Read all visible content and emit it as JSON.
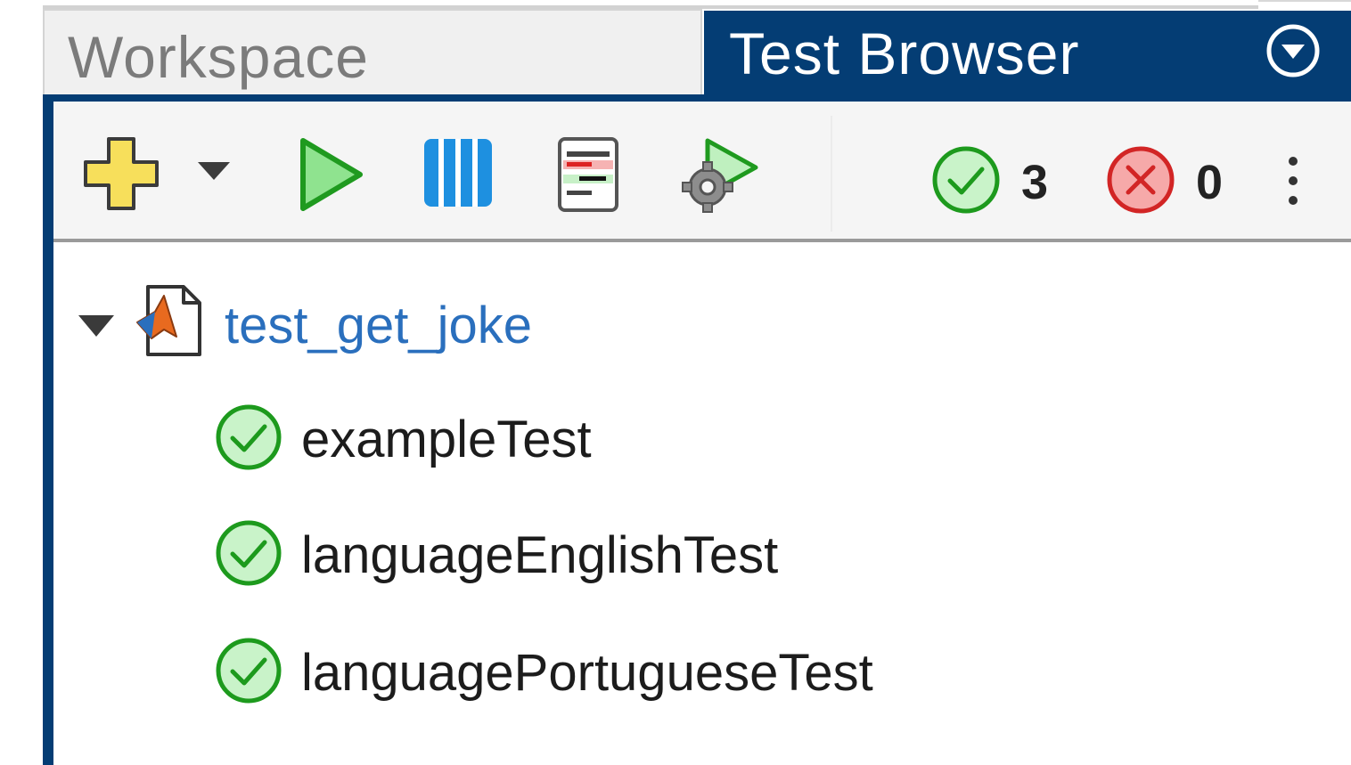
{
  "tabs": [
    {
      "label": "Workspace",
      "active": false
    },
    {
      "label": "Test Browser",
      "active": true
    }
  ],
  "colors": {
    "active_tab": "#043d74",
    "pass": "#2aa52a",
    "fail": "#d62c2c",
    "link": "#2a6fbd"
  },
  "toolbar": {
    "icons": [
      "add-test-icon",
      "dropdown-arrow-icon",
      "run-icon",
      "run-parallel-icon",
      "test-report-icon",
      "run-with-options-icon"
    ]
  },
  "summary": {
    "passed": "3",
    "failed": "0"
  },
  "tree": {
    "root": {
      "label": "test_get_joke",
      "expanded": true,
      "icon": "matlab-file-icon"
    },
    "tests": [
      {
        "name": "exampleTest",
        "status": "passed"
      },
      {
        "name": "languageEnglishTest",
        "status": "passed"
      },
      {
        "name": "languagePortugueseTest",
        "status": "passed"
      }
    ]
  }
}
